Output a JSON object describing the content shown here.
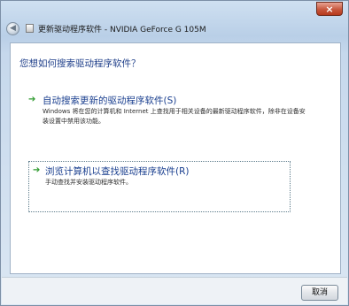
{
  "window": {
    "title": "更新驱动程序软件 - NVIDIA GeForce G 105M",
    "close_glyph": "×"
  },
  "nav": {
    "back_glyph": "◀"
  },
  "main": {
    "heading": "您想如何搜索驱动程序软件？",
    "options": [
      {
        "icon": "green-arrow-icon",
        "title": "自动搜索更新的驱动程序软件(S)",
        "description": "Windows 将在您的计算机和 Internet 上查找用于相关设备的最新驱动程序软件，除非在设备安装设置中禁用该功能。"
      },
      {
        "icon": "green-arrow-icon",
        "title": "浏览计算机以查找驱动程序软件(R)",
        "description": "手动查找并安装驱动程序软件。"
      }
    ]
  },
  "footer": {
    "cancel_label": "取消"
  },
  "colors": {
    "link_blue": "#1a3f8f",
    "arrow_green": "#2e9a2e"
  }
}
